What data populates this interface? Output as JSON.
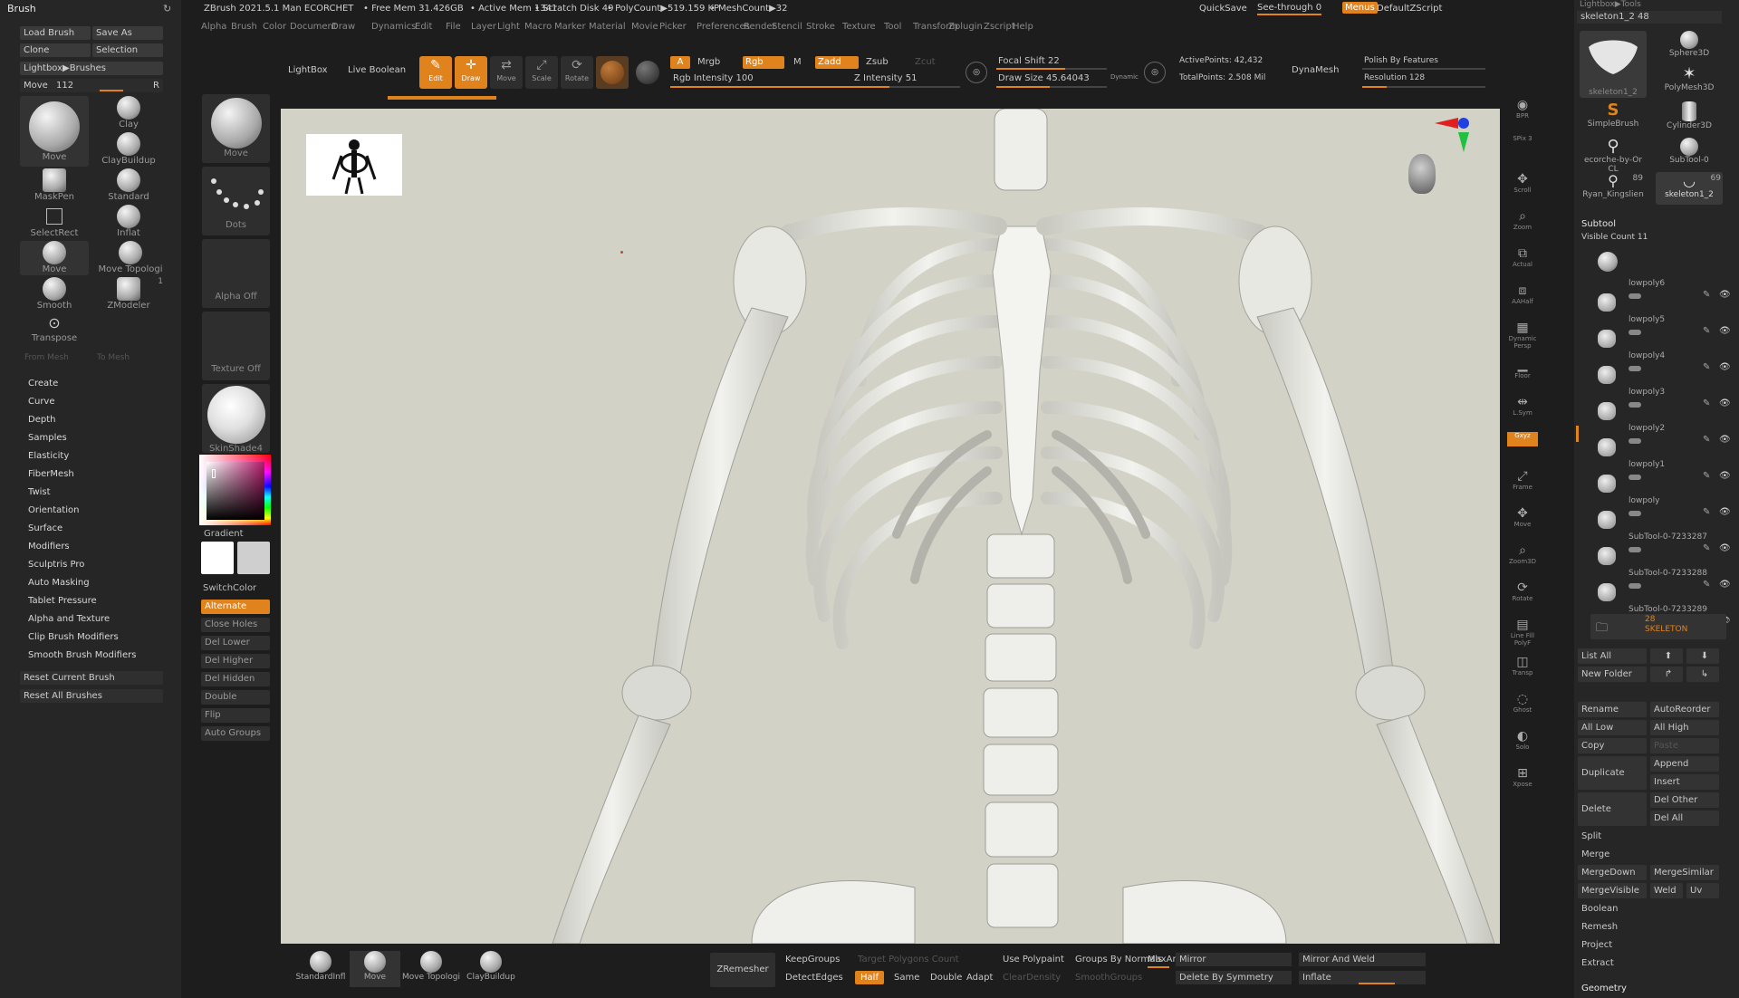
{
  "top": {
    "title": "ZBrush 2021.5.1 Man ECORCHET",
    "free_mem": "• Free Mem 31.426GB",
    "active_mem": "• Active Mem 1341",
    "scratch": "• Scratch Disk 49",
    "polycount": "• PolyCount▶519.159 KP",
    "meshcount": "• MeshCount▶32",
    "quicksave": "QuickSave",
    "see_through": "See-through  0",
    "menus": "Menus",
    "default_zscript": "DefaultZScript",
    "menu_items": [
      "Alpha",
      "Brush",
      "Color",
      "Document",
      "Draw",
      "Dynamics",
      "Edit",
      "File",
      "Layer",
      "Light",
      "Macro",
      "Marker",
      "Material",
      "Movie",
      "Picker",
      "Preferences",
      "Render",
      "Stencil",
      "Stroke",
      "Texture",
      "Tool",
      "Transform",
      "Zplugin",
      "Zscript",
      "Help"
    ]
  },
  "brush_panel": {
    "title": "Brush",
    "load_brush": "Load Brush",
    "save_as": "Save As",
    "clone": "Clone",
    "selection": "Selection",
    "lightbox_brushes": "Lightbox▶Brushes",
    "move_label": "Move",
    "move_value": "112",
    "r_label": "R",
    "brushes": [
      "Move",
      "Clay",
      "ClayBuildup",
      "MaskPen",
      "Standard",
      "SelectRect",
      "Inflat",
      "Move",
      "Move Topologi",
      "Smooth",
      "ZModeler",
      "Transpose"
    ],
    "zmodeler_count": "1",
    "from_mesh": "From Mesh",
    "to_mesh": "To Mesh",
    "menu_items": [
      "Create",
      "Curve",
      "Depth",
      "Samples",
      "Elasticity",
      "FiberMesh",
      "Twist",
      "Orientation",
      "Surface",
      "Modifiers",
      "Sculptris Pro",
      "Auto Masking",
      "Tablet Pressure",
      "Alpha and Texture",
      "Clip Brush Modifiers",
      "Smooth Brush Modifiers"
    ],
    "reset_current": "Reset Current Brush",
    "reset_all": "Reset All Brushes"
  },
  "tool_column": {
    "move": "Move",
    "dots": "Dots",
    "alpha_off": "Alpha Off",
    "texture_off": "Texture Off",
    "material": "SkinShade4",
    "gradient": "Gradient",
    "switch_color": "SwitchColor",
    "alternate": "Alternate",
    "buttons": [
      "Close Holes",
      "Del Lower",
      "Del Higher",
      "Del Hidden",
      "Double",
      "Flip",
      "Auto Groups"
    ]
  },
  "toolbar": {
    "lightbox": "LightBox",
    "live_boolean": "Live Boolean",
    "edit": "Edit",
    "draw": "Draw",
    "move": "Move",
    "scale": "Scale",
    "rotate": "Rotate",
    "a_label": "A",
    "mrgb": "Mrgb",
    "rgb": "Rgb",
    "m": "M",
    "rgb_intensity": "Rgb Intensity 100",
    "zadd": "Zadd",
    "zsub": "Zsub",
    "zcut": "Zcut",
    "z_intensity": "Z Intensity 51",
    "focal_shift": "Focal Shift 22",
    "draw_size": "Draw Size 45.64043",
    "dynamic": "Dynamic",
    "active_points": "ActivePoints: 42,432",
    "total_points": "TotalPoints: 2.508 Mil",
    "dynamesh": "DynaMesh",
    "polish": "Polish By Features",
    "resolution": "Resolution 128"
  },
  "shelf": {
    "items": [
      "BPR",
      "SPix 3",
      "Scroll",
      "Zoom",
      "Actual",
      "AAHalf",
      "Dynamic Persp",
      "Floor",
      "L.Sym",
      "Gxyz",
      "Frame",
      "Move",
      "Zoom3D",
      "Rotate",
      "Line Fill PolyF",
      "Transp",
      "Ghost",
      "Solo",
      "Xpose"
    ]
  },
  "right_panel": {
    "header": "Lightbox▶Tools",
    "skeleton_label": "skeleton1_2  48",
    "tools": [
      "skeleton1_2",
      "Sphere3D",
      "SimpleBrush",
      "PolyMesh3D",
      "ecorche-by-Or CL",
      "Cylinder3D",
      "Ryan_Kingslien",
      "skeleton1_2",
      "SubTool-0"
    ],
    "count_89": "89",
    "count_69": "69",
    "subtool": "Subtool",
    "visible_count": "Visible Count 11",
    "subtools": [
      "lowpoly6",
      "lowpoly5",
      "lowpoly4",
      "lowpoly3",
      "lowpoly2",
      "lowpoly1",
      "lowpoly",
      "SubTool-0-7233287",
      "SubTool-0-7233288",
      "SubTool-0-7233289"
    ],
    "skeleton_folder": "SKELETON",
    "folder_count": "28",
    "list_all": "List All",
    "new_folder": "New Folder",
    "rename": "Rename",
    "auto_reorder": "AutoReorder",
    "all_low": "All Low",
    "all_high": "All High",
    "copy": "Copy",
    "paste": "Paste",
    "duplicate": "Duplicate",
    "append": "Append",
    "insert": "Insert",
    "delete": "Delete",
    "del_other": "Del Other",
    "del_all": "Del All",
    "split": "Split",
    "merge": "Merge",
    "merge_down": "MergeDown",
    "merge_similar": "MergeSimilar",
    "merge_visible": "MergeVisible",
    "weld": "Weld",
    "uv": "Uv",
    "boolean": "Boolean",
    "remesh": "Remesh",
    "project": "Project",
    "extract": "Extract",
    "geometry": "Geometry"
  },
  "bottom": {
    "brushes": [
      "StandardInfl",
      "Move",
      "Move Topologi",
      "ClayBuildup"
    ],
    "zremesher": "ZRemesher",
    "keep_groups": "KeepGroups",
    "target_polygons": "Target Polygons Count",
    "detect_edges": "DetectEdges",
    "half": "Half",
    "same": "Same",
    "double": "Double",
    "adapt": "Adapt",
    "clear_density": "ClearDensity",
    "use_polypaint": "Use Polypaint",
    "groups_by_normals": "Groups By Normals",
    "smooth_groups": "SmoothGroups",
    "max_angle": "MaxAng",
    "mirror": "Mirror",
    "delete_by_symmetry": "Delete By Symmetry",
    "mirror_and_weld": "Mirror And Weld",
    "inflate": "Inflate"
  },
  "colors": {
    "accent": "#e0831d",
    "panel": "#262626",
    "viewport_bg": "#d2d2c7",
    "bone": "#ebebe6"
  }
}
